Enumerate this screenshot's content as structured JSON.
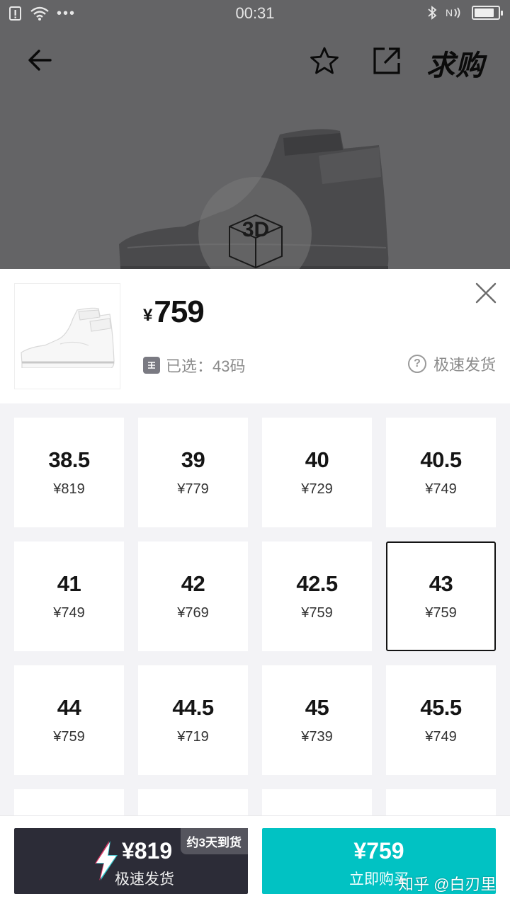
{
  "status_bar": {
    "time": "00:31",
    "battery_level": 0.85,
    "icons": [
      "sim-alert-icon",
      "wifi-icon",
      "more-dots-icon",
      "bluetooth-icon",
      "nfc-icon",
      "battery-icon"
    ],
    "dots": "•••"
  },
  "nav": {
    "back_icon": "arrow-left-icon",
    "favorite_icon": "star-outline-icon",
    "share_icon": "share-external-icon",
    "want_label": "求购"
  },
  "product": {
    "badge_3d": "3D",
    "price_currency": "¥",
    "price_value": "759",
    "selected_text": "已选：43码",
    "fast_ship_label": "极速发货"
  },
  "sizes": [
    {
      "size": "38.5",
      "price": "¥819"
    },
    {
      "size": "39",
      "price": "¥779"
    },
    {
      "size": "40",
      "price": "¥729"
    },
    {
      "size": "40.5",
      "price": "¥749"
    },
    {
      "size": "41",
      "price": "¥749"
    },
    {
      "size": "42",
      "price": "¥769"
    },
    {
      "size": "42.5",
      "price": "¥759"
    },
    {
      "size": "43",
      "price": "¥759",
      "selected": true
    },
    {
      "size": "44",
      "price": "¥759"
    },
    {
      "size": "44.5",
      "price": "¥719"
    },
    {
      "size": "45",
      "price": "¥739"
    },
    {
      "size": "45.5",
      "price": "¥749"
    },
    {
      "size": "",
      "price": ""
    },
    {
      "size": "",
      "price": ""
    },
    {
      "size": "",
      "price": ""
    },
    {
      "size": "",
      "price": ""
    }
  ],
  "actions": {
    "fast": {
      "tag": "约3天到货",
      "price": "¥819",
      "label": "极速发货"
    },
    "buy": {
      "price": "¥759",
      "label": "立即购买"
    }
  },
  "watermark": "知乎 @白刃里",
  "colors": {
    "accent": "#01c2c3",
    "dark_button": "#2c2c37",
    "overlay": "#646466"
  }
}
